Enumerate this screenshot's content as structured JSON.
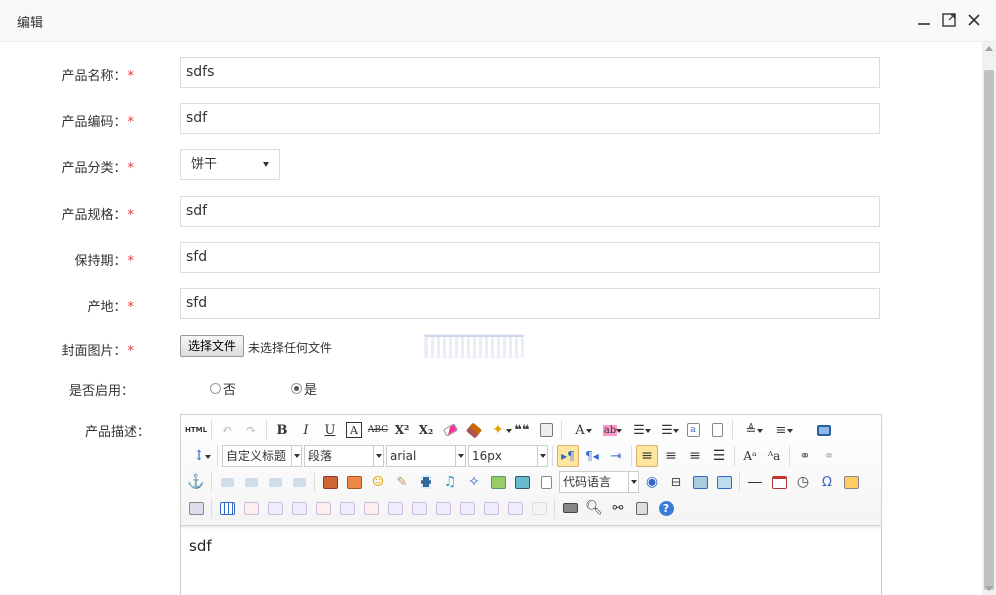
{
  "dialog": {
    "title": "编辑"
  },
  "form": {
    "name": {
      "label": "产品名称：",
      "required": "*",
      "value": "sdfs"
    },
    "code": {
      "label": "产品编码：",
      "required": "*",
      "value": "sdf"
    },
    "category": {
      "label": "产品分类：",
      "required": "*",
      "value": "饼干"
    },
    "spec": {
      "label": "产品规格：",
      "required": "*",
      "value": "sdf"
    },
    "shelf_life": {
      "label": "保持期：",
      "required": "*",
      "value": "sfd"
    },
    "origin": {
      "label": "产地：",
      "required": "*",
      "value": "sfd"
    },
    "cover": {
      "label": "封面图片：",
      "required": "*",
      "button": "选择文件",
      "status": "未选择任何文件"
    },
    "enabled": {
      "label": "是否启用：",
      "option_no": "否",
      "option_yes": "是",
      "selected": "是"
    },
    "description": {
      "label": "产品描述：",
      "content": "sdf"
    }
  },
  "editor": {
    "html_label": "HTML",
    "heading_combo": "自定义标题",
    "paragraph_combo": "段落",
    "font_combo": "arial",
    "size_combo": "16px",
    "code_lang_combo": "代码语言",
    "bold": "B",
    "italic": "I",
    "underline": "U",
    "fontborder": "A",
    "strike": "ABC",
    "superscript": "X²",
    "subscript": "X₂",
    "quote": "❝❝",
    "fontcolor": "A",
    "omega": "Ω",
    "help": "?"
  }
}
